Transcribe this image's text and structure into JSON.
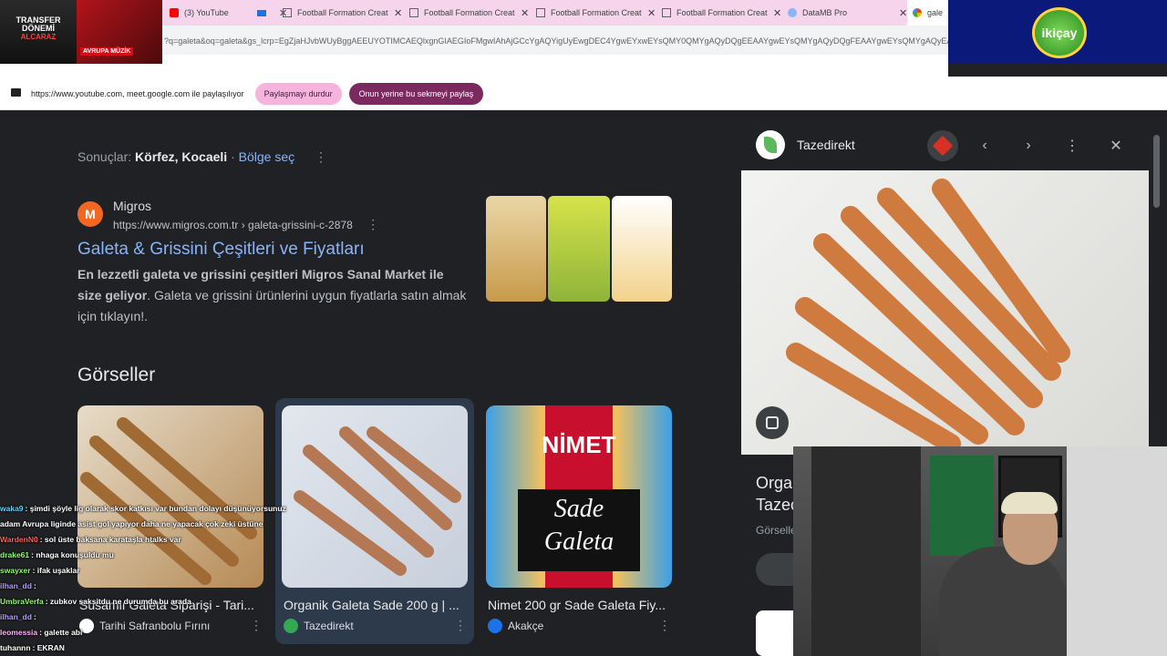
{
  "browser": {
    "tabs": [
      {
        "title": "(3) YouTube",
        "active": false
      },
      {
        "title": "Football Formation Creat",
        "active": false
      },
      {
        "title": "Football Formation Creat",
        "active": false
      },
      {
        "title": "Football Formation Creat",
        "active": false
      },
      {
        "title": "Football Formation Creat",
        "active": false
      },
      {
        "title": "DataMB Pro",
        "active": false
      },
      {
        "title": "galeta",
        "active": true
      }
    ],
    "url": "?q=galeta&oq=galeta&gs_lcrp=EgZjaHJvbWUyBggAEEUYOTIMCAEQlxgnGIAEGIoFMgwIAhAjGCcYgAQYigUyEwgDEC4YgwEYxwEYsQMY0QMYgAQyDQgEEAAYgwEYsQMYgAQyDQgFEAAYgwEYsQMYgAQyEAgG"
  },
  "sharing": {
    "text": "https://www.youtube.com, meet.google.com ile paylaşılıyor",
    "stop_label": "Paylaşmayı durdur",
    "share_label": "Onun yerine bu sekmeyi paylaş"
  },
  "overlay": {
    "thumb_title": "TRANSFER DÖNEMİ",
    "thumb_name": "ALCARAZ",
    "thumb_tag": "AVRUPA MÜZİK",
    "brand": "ikiçay"
  },
  "search": {
    "results_prefix": "Sonuçlar:",
    "results_location": "Körfez, Kocaeli",
    "results_sep": "·",
    "results_link": "Bölge seç",
    "result": {
      "logo_letter": "M",
      "site": "Migros",
      "url": "https://www.migros.com.tr › galeta-grissini-c-2878",
      "title": "Galeta & Grissini Çeşitleri ve Fiyatları",
      "snippet_bold": "En lezzetli galeta ve grissini çeşitleri Migros Sanal Market ile size geliyor",
      "snippet_rest": ". Galeta ve grissini ürünlerini uygun fiyatlarla satın almak için tıklayın!."
    },
    "images_heading": "Görseller",
    "images": [
      {
        "caption": "Susamlı Galeta Siparişi - Tari...",
        "source": "Tarihi Safranbolu Fırını",
        "icon_color": "#ffffff"
      },
      {
        "caption": "Organik Galeta Sade 200 g | ...",
        "source": "Tazedirekt",
        "icon_color": "#34a853"
      },
      {
        "caption": "Nimet 200 gr Sade Galeta Fiy...",
        "source": "Akakçe",
        "icon_color": "#1a73e8"
      }
    ],
    "nimet_brand": "NİMET",
    "nimet_product_1": "Sade",
    "nimet_product_2": "Galeta"
  },
  "panel": {
    "source": "Tazedirekt",
    "title_1": "Orga",
    "title_2": "Tazec",
    "sub": "Görselle"
  },
  "chat": [
    {
      "user": "waka9",
      "color": "#5fd4ff",
      "msg": ": şimdi şöyle lig olarak skor katkısı var bundan dolayı düşünüyorsunuz"
    },
    {
      "user": "",
      "color": "#ffffff",
      "msg": "adam Avrupa liginde asist gol yapıyor daha ne yapacak çok zeki üstüne"
    },
    {
      "user": "WardenN0",
      "color": "#ff5c5c",
      "msg": ": sol üste baksana karataşla htalks var"
    },
    {
      "user": "drake61",
      "color": "#8cff66",
      "msg": ": nhaga konuşuldu mu"
    },
    {
      "user": "swayxer",
      "color": "#8cff66",
      "msg": ": ifak uşaklar"
    },
    {
      "user": "ilhan_dd",
      "color": "#b49cff",
      "msg": ":"
    },
    {
      "user": "UmbraVerfa",
      "color": "#8cff66",
      "msg": ": zubkov saksitdu ne durumda bu arada"
    },
    {
      "user": "ilhan_dd",
      "color": "#b49cff",
      "msg": ":"
    },
    {
      "user": "leomessia",
      "color": "#ffb3ff",
      "msg": ": galette abi"
    },
    {
      "user": "tuhannn",
      "color": "#ffffff",
      "msg": ": EKRAN"
    }
  ]
}
